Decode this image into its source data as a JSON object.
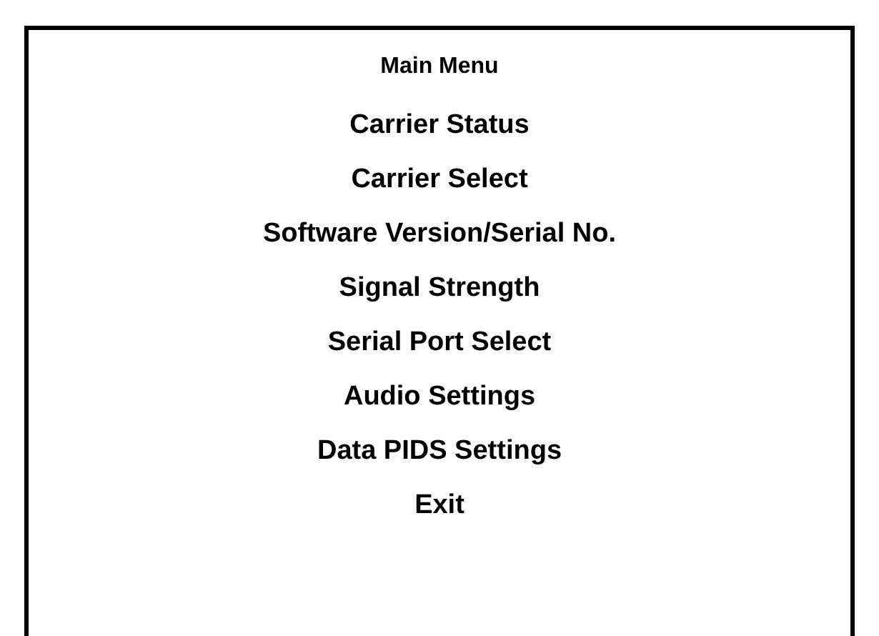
{
  "menu": {
    "title": "Main Menu",
    "items": [
      "Carrier Status",
      "Carrier Select",
      "Software Version/Serial No.",
      "Signal Strength",
      "Serial Port Select",
      "Audio Settings",
      "Data PIDS Settings",
      "Exit"
    ]
  }
}
